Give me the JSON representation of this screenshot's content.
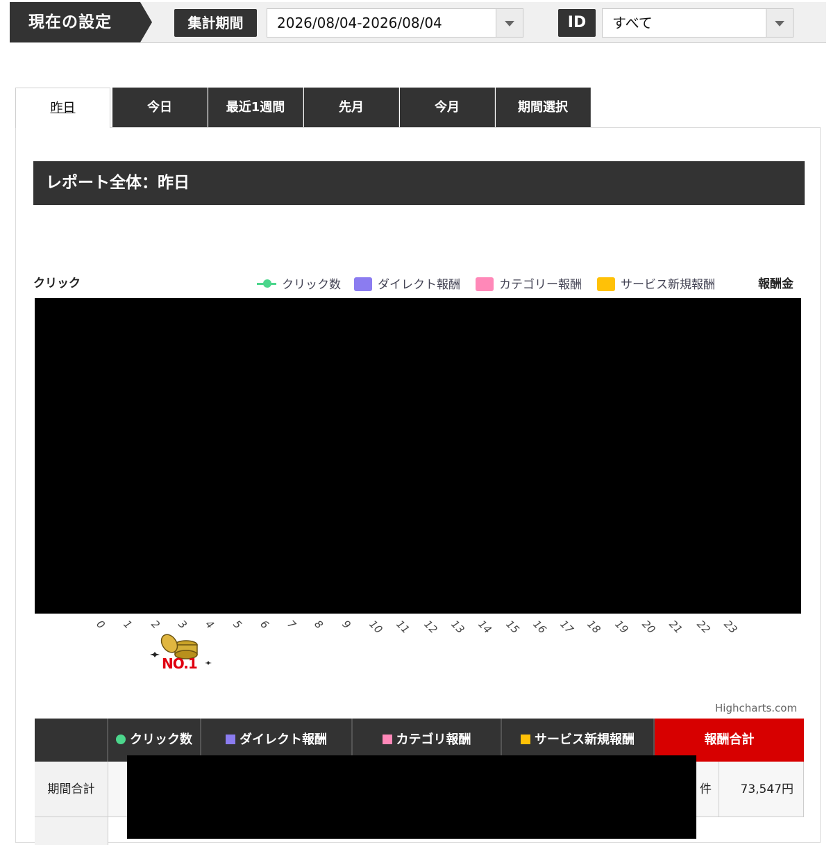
{
  "topbar": {
    "current_settings": "現在の設定",
    "period_label": "集計期間",
    "period_value": "2026/08/04-2026/08/04",
    "id_label": "ID",
    "id_value": "すべて"
  },
  "tabs": [
    {
      "label": "昨日",
      "active": true
    },
    {
      "label": "今日"
    },
    {
      "label": "最近1週間"
    },
    {
      "label": "先月"
    },
    {
      "label": "今月"
    },
    {
      "label": "期間選択"
    }
  ],
  "report": {
    "title": "レポート全体：昨日"
  },
  "chart_data": {
    "type": "bar",
    "y_left_label": "クリック",
    "y_right_label": "報酬金",
    "legend_position": "top-right",
    "series": [
      {
        "name": "クリック数",
        "type": "line",
        "color": "#4cd68c"
      },
      {
        "name": "ダイレクト報酬",
        "color": "#8b7cf0"
      },
      {
        "name": "カテゴリー報酬",
        "color": "#ff88b8"
      },
      {
        "name": "サービス新規報酬",
        "color": "#ffc107"
      }
    ],
    "categories": [
      "0",
      "1",
      "2",
      "3",
      "4",
      "5",
      "6",
      "7",
      "8",
      "9",
      "10",
      "11",
      "12",
      "13",
      "14",
      "15",
      "16",
      "17",
      "18",
      "19",
      "20",
      "21",
      "22",
      "23"
    ],
    "credit": "Highcharts.com"
  },
  "badge": {
    "text": "NO.1"
  },
  "summary_table": {
    "headers": [
      {
        "label": "",
        "color": ""
      },
      {
        "label": "クリック数",
        "color": "#4cd68c",
        "shape": "circle"
      },
      {
        "label": "ダイレクト報酬",
        "color": "#8b7cf0",
        "shape": "square"
      },
      {
        "label": "カテゴリ報酬",
        "color": "#ff88b8",
        "shape": "square"
      },
      {
        "label": "サービス新規報酬",
        "color": "#ffc107",
        "shape": "square"
      },
      {
        "label": "報酬合計",
        "color": "#d70000"
      }
    ],
    "row_label": "期間合計",
    "count_suffix": "件",
    "total": "73,547円"
  }
}
